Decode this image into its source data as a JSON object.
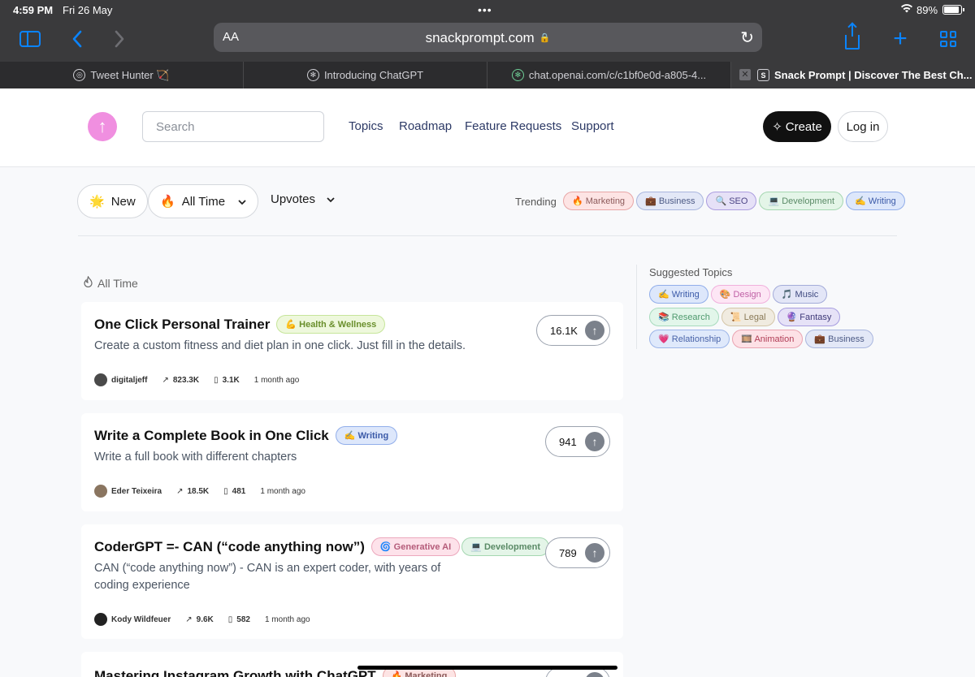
{
  "status_bar": {
    "time": "4:59 PM",
    "date": "Fri 26 May",
    "battery": "89%"
  },
  "browser": {
    "aa_label": "AA",
    "url": "snackprompt.com",
    "tabs": [
      {
        "title": "Tweet Hunter",
        "suffix": "🏹"
      },
      {
        "title": "Introducing ChatGPT"
      },
      {
        "title": "chat.openai.com/c/c1bf0e0d-a805-4..."
      },
      {
        "title": "Snack Prompt | Discover The Best Ch..."
      }
    ]
  },
  "header": {
    "search_placeholder": "Search",
    "nav": [
      "Topics",
      "Roadmap",
      "Feature Requests",
      "Support"
    ],
    "create_label": "Create",
    "login_label": "Log in"
  },
  "filters": {
    "new_label": "New",
    "new_icon": "🌟",
    "alltime_label": "All Time",
    "alltime_icon": "🔥",
    "upvotes_label": "Upvotes",
    "trending_label": "Trending",
    "trending": [
      {
        "label": "🔥 Marketing"
      },
      {
        "label": "💼 Business"
      },
      {
        "label": "🔍 SEO"
      },
      {
        "label": "💻 Development"
      },
      {
        "label": "✍️ Writing"
      }
    ]
  },
  "feed": {
    "heading": "All Time",
    "cards": [
      {
        "title": "One Click Personal Trainer",
        "tags": [
          "💪 Health & Wellness"
        ],
        "desc": "Create a custom fitness and diet plan in one click. Just fill in the details.",
        "author": "digitaljeff",
        "views": "823.3K",
        "saves": "3.1K",
        "time": "1 month ago",
        "votes": "16.1K"
      },
      {
        "title": "Write a Complete Book in One Click",
        "tags": [
          "✍️ Writing"
        ],
        "desc": "Write a full book with different chapters",
        "author": "Eder Teixeira",
        "views": "18.5K",
        "saves": "481",
        "time": "1 month ago",
        "votes": "941"
      },
      {
        "title": "CoderGPT =- CAN (“code anything now”)",
        "tags": [
          "🌀 Generative AI",
          "💻 Development"
        ],
        "desc": "CAN (“code anything now”) - CAN is an expert coder, with years of coding experience",
        "author": "Kody Wildfeuer",
        "views": "9.6K",
        "saves": "582",
        "time": "1 month ago",
        "votes": "789"
      },
      {
        "title": "Mastering Instagram Growth with ChatGPT",
        "tags": [
          "🔥 Marketing"
        ]
      }
    ]
  },
  "sidebar": {
    "heading": "Suggested Topics",
    "topics": [
      "✍️ Writing",
      "🎨 Design",
      "🎵 Music",
      "📚 Research",
      "📜 Legal",
      "🔮 Fantasy",
      "💗 Relationship",
      "🎞️ Animation",
      "💼 Business"
    ]
  }
}
